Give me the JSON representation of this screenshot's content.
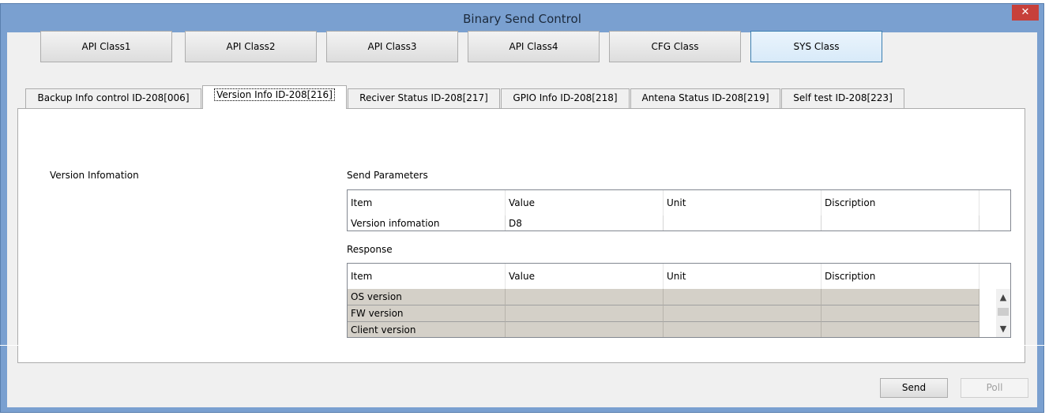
{
  "window": {
    "title": "Binary Send Control",
    "close_label": "✕"
  },
  "class_buttons": [
    "API Class1",
    "API Class2",
    "API Class3",
    "API Class4",
    "CFG Class",
    "SYS Class"
  ],
  "active_class": "SYS Class",
  "tabs": [
    "Backup Info control ID-208[006]",
    "Version Info ID-208[216]",
    "Reciver Status ID-208[217]",
    "GPIO Info ID-208[218]",
    "Antena Status ID-208[219]",
    "Self test ID-208[223]"
  ],
  "active_tab": "Version Info ID-208[216]",
  "section_label": "Version Infomation",
  "send_parameters": {
    "label": "Send Parameters",
    "columns": [
      "Item",
      "Value",
      "Unit",
      "Discription"
    ],
    "rows": [
      [
        "Version infomation",
        "D8",
        "",
        ""
      ]
    ]
  },
  "response": {
    "label": "Response",
    "columns": [
      "Item",
      "Value",
      "Unit",
      "Discription"
    ],
    "rows": [
      [
        "OS version",
        "",
        "",
        ""
      ],
      [
        "FW version",
        "",
        "",
        ""
      ],
      [
        "Client version",
        "",
        "",
        ""
      ]
    ]
  },
  "buttons": {
    "send": "Send",
    "poll": "Poll"
  },
  "icons": {
    "scroll_up": "chevron-up-icon",
    "scroll_down": "chevron-down-icon"
  },
  "colors": {
    "title_bar": "#7aa0d0",
    "close": "#c7403a",
    "active_button": "#d8eaf9",
    "response_rows": "#d4d0c8"
  }
}
